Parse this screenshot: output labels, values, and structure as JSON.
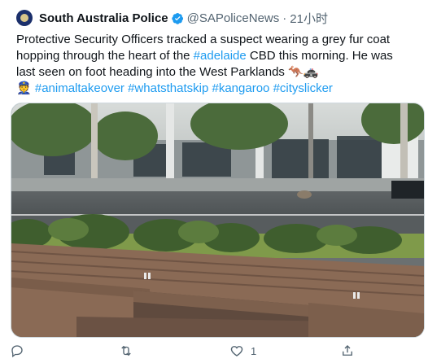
{
  "author": {
    "name": "South Australia Police",
    "handle": "@SAPoliceNews",
    "separator": "·",
    "time": "21小时"
  },
  "tweet": {
    "line1": "Protective Security Officers tracked a suspect wearing a grey fur coat",
    "line2": "hopping through the heart of the #adelaide CBD this morning. He was",
    "line3": "last seen on foot heading into the West Parklands 🦘🚓",
    "line4": "👮 #animaltakeover #whatsthatskip #kangaroo #cityslicker"
  },
  "colors": {
    "link": "#1d9bf0",
    "verified": "#1d9bf0",
    "text": "#0f1419",
    "muted": "#536471"
  },
  "actions": {
    "like_count": "1"
  },
  "icons": [
    "verified-badge-icon",
    "reply-icon",
    "retweet-icon",
    "like-icon",
    "share-icon"
  ]
}
